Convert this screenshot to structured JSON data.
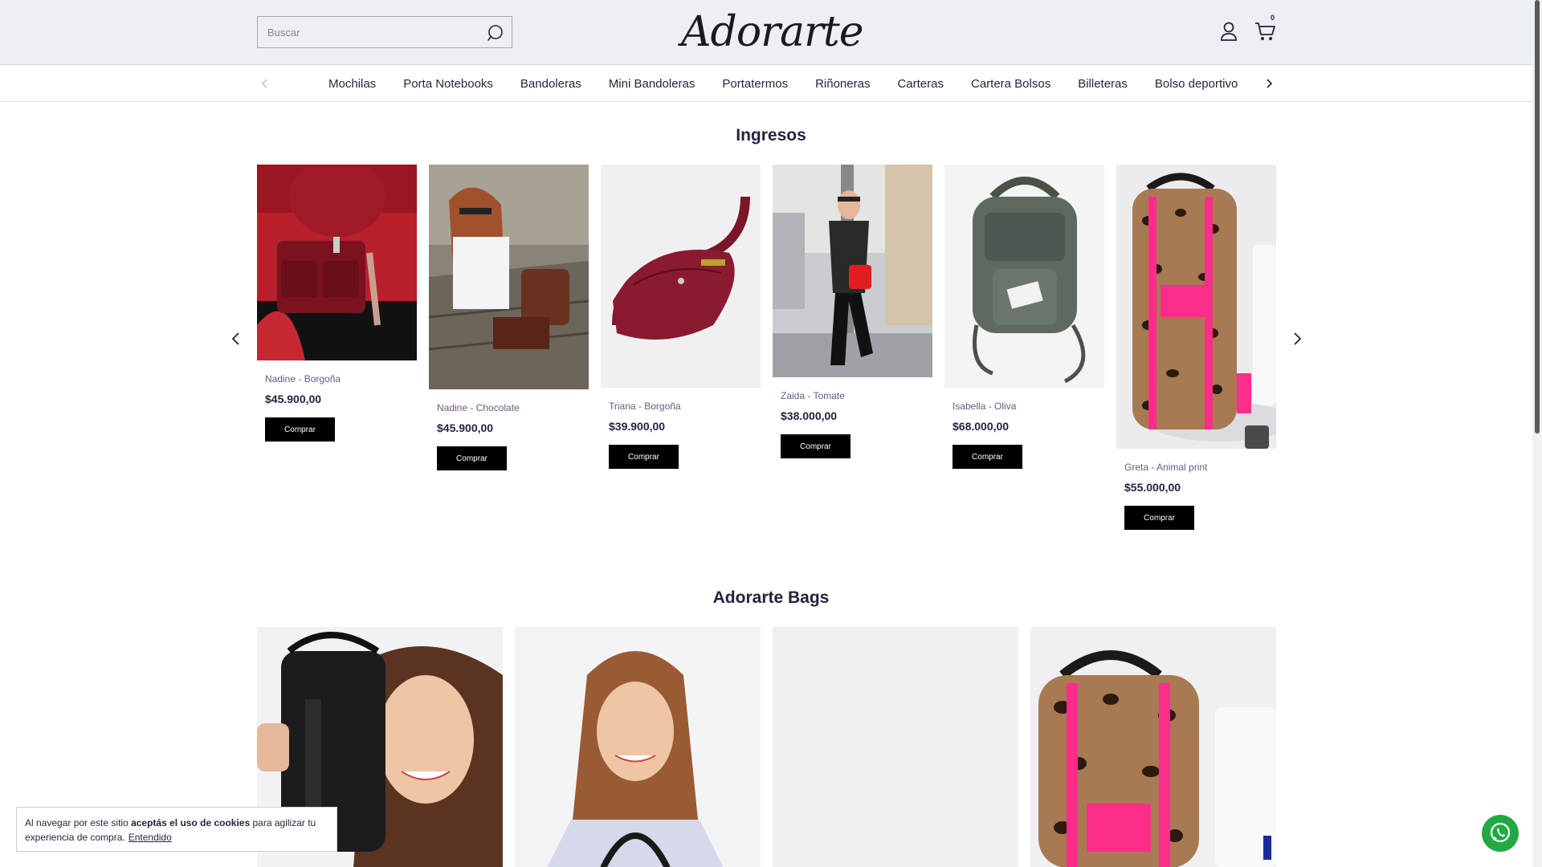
{
  "header": {
    "search_placeholder": "Buscar",
    "logo_text": "Adorarte",
    "cart_count": "0"
  },
  "nav": {
    "items": [
      "Mochilas",
      "Porta Notebooks",
      "Bandoleras",
      "Mini Bandoleras",
      "Portatermos",
      "Riñoneras",
      "Carteras",
      "Cartera Bolsos",
      "Billeteras",
      "Bolso deportivo"
    ]
  },
  "sections": {
    "ingresos_title": "Ingresos",
    "bags_title": "Adorarte Bags"
  },
  "products": [
    {
      "name": "Nadine - Borgoña",
      "price": "$45.900,00",
      "buy_label": "Comprar"
    },
    {
      "name": "Nadine - Chocolate",
      "price": "$45.900,00",
      "buy_label": "Comprar"
    },
    {
      "name": "Triana - Borgoña",
      "price": "$39.900,00",
      "buy_label": "Comprar"
    },
    {
      "name": "Zaida - Tomate",
      "price": "$38.000,00",
      "buy_label": "Comprar"
    },
    {
      "name": "Isabella - Oliva",
      "price": "$68.000,00",
      "buy_label": "Comprar"
    },
    {
      "name": "Greta - Animal print",
      "price": "$55.000,00",
      "buy_label": "Comprar"
    }
  ],
  "cookie": {
    "text_before": "Al navegar por este sitio ",
    "text_bold": "aceptás el uso de cookies",
    "text_after": " para agilizar tu experiencia de compra.",
    "accept_label": "Entendido"
  },
  "colors": {
    "header_bg": "#eceff3",
    "text_primary": "#2b1f3d",
    "button_bg": "#000000",
    "accent_pink": "#ff2d8a",
    "whatsapp": "#1faa44"
  }
}
